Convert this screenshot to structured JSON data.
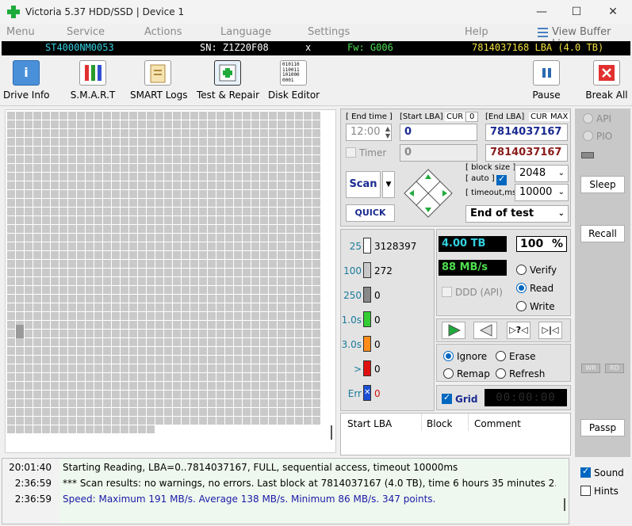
{
  "window": {
    "title": "Victoria 5.37 HDD/SSD | Device 1",
    "minimize": "—",
    "maximize": "☐",
    "close": "✕"
  },
  "menu": {
    "items": [
      "Menu",
      "Service",
      "Actions",
      "Language",
      "Settings",
      "Help"
    ],
    "view_buffer": "View Buffer Live"
  },
  "infobar": {
    "model": "ST4000NM0053",
    "serial": "SN: Z1Z20F08",
    "close": "x",
    "firmware": "Fw: G006",
    "lba": "7814037168 LBA (4.0 TB)"
  },
  "toolbar": {
    "drive_info": "Drive Info",
    "smart": "S.M.A.R.T",
    "smart_logs": "SMART Logs",
    "test_repair": "Test & Repair",
    "disk_editor": "Disk Editor",
    "pause": "Pause",
    "break_all": "Break All",
    "disk_editor_icon_text": "010110\n110011\n101000\n0001"
  },
  "test": {
    "end_time_label": "[ End time ]",
    "end_time": "12:00",
    "timer_label": "Timer",
    "start_lba_label": "[Start LBA]",
    "cur_label": "CUR",
    "cur_value": "0",
    "start_lba": "0",
    "start_lba_second": "0",
    "end_lba_label": "[End LBA]",
    "cur_label2": "CUR",
    "max_label": "MAX",
    "end_lba": "7814037167",
    "end_lba_second": "7814037167",
    "scan": "Scan",
    "quick": "QUICK",
    "block_size_label": "[ block size ]",
    "auto_label": "[ auto ]",
    "block_size": "2048",
    "timeout_label": "[ timeout,ms ]",
    "timeout": "10000",
    "end_action": "End of test"
  },
  "stats": {
    "rows": [
      {
        "label": "25",
        "value": "3128397",
        "color": "#ffffff"
      },
      {
        "label": "100",
        "value": "272",
        "color": "#c8c8c8"
      },
      {
        "label": "250",
        "value": "0",
        "color": "#888888"
      },
      {
        "label": "1.0s",
        "value": "0",
        "color": "#33cc33"
      },
      {
        "label": "3.0s",
        "value": "0",
        "color": "#ff8c1a"
      },
      {
        "label": ">",
        "value": "0",
        "color": "#e01010"
      },
      {
        "label": "Err",
        "value": "0",
        "color": "#1a4fd6"
      }
    ],
    "size": "4.00 TB",
    "percent": "100",
    "percent_unit": "%",
    "speed": "88 MB/s",
    "ddd": "DDD (API)",
    "verify": "Verify",
    "read": "Read",
    "write": "Write",
    "ignore": "Ignore",
    "erase": "Erase",
    "remap": "Remap",
    "refresh": "Refresh",
    "grid": "Grid",
    "timer_display": "00:00:00"
  },
  "table": {
    "columns": [
      "Start LBA",
      "Block",
      "Comment"
    ]
  },
  "side": {
    "api": "API",
    "pio": "PIO",
    "sleep": "Sleep",
    "recall": "Recall",
    "wr": "WR",
    "rd": "RD",
    "passp": "Passp",
    "sound": "Sound",
    "hints": "Hints"
  },
  "log": [
    {
      "time": "20:01:40",
      "msg": "Starting Reading, LBA=0..7814037167, FULL, sequential access, timeout 10000ms",
      "color": "#000000"
    },
    {
      "time": "2:36:59",
      "msg": "*** Scan results: no warnings, no errors. Last block at 7814037167 (4.0 TB), time 6 hours 35 minutes 2...",
      "color": "#000000"
    },
    {
      "time": "2:36:59",
      "msg": "Speed: Maximum 191 MB/s. Average 138 MB/s. Minimum 86 MB/s. 347 points.",
      "color": "#1a1aa8"
    }
  ],
  "colors": {
    "accent": "#0067c0",
    "green_icon": "#1faa3a",
    "cyan": "#35d0e0",
    "yellow": "#f0e040",
    "lime": "#4ee04e",
    "red_button": "#e23030"
  }
}
